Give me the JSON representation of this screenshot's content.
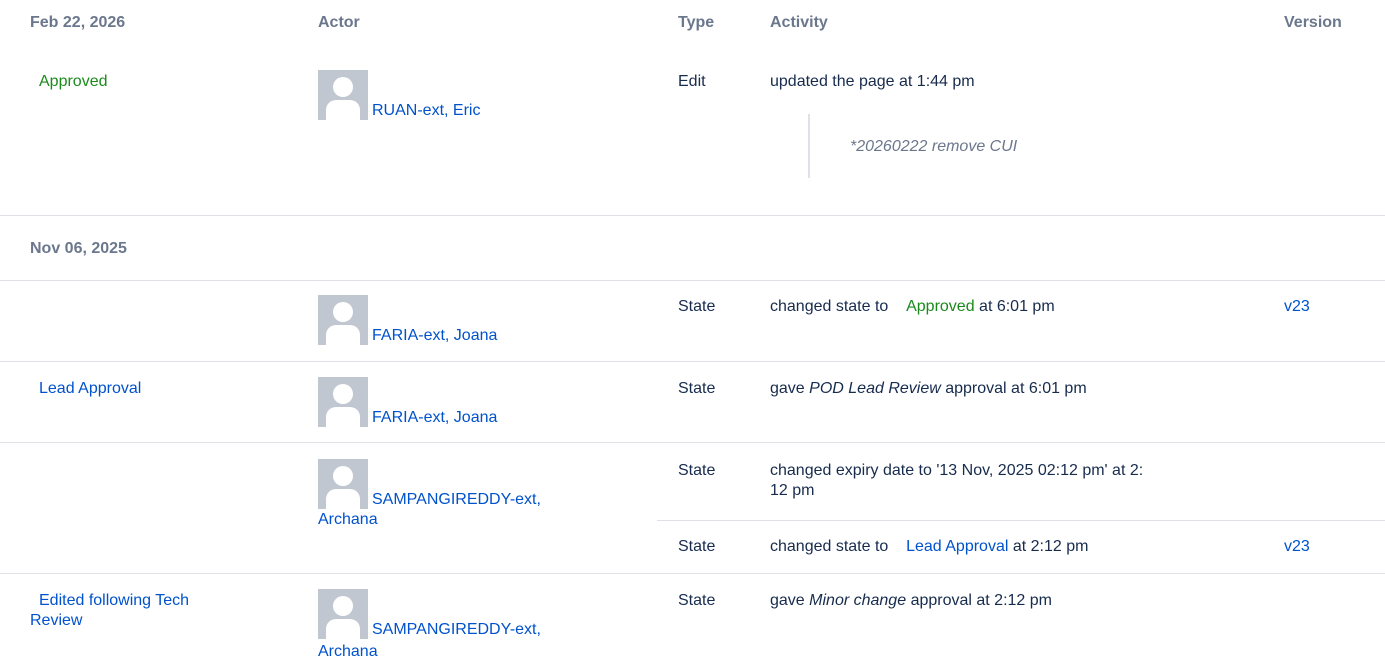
{
  "header": {
    "date": "Feb 22, 2026",
    "actor": "Actor",
    "type": "Type",
    "activity": "Activity",
    "version": "Version"
  },
  "groups": [
    {
      "entries": [
        {
          "state": "Approved",
          "actor": "RUAN-ext, Eric",
          "type": "Edit",
          "activity": "updated the page at 1:44 pm",
          "comment": "*20260222 remove CUI"
        }
      ]
    },
    {
      "date": "Nov 06, 2025",
      "entries": [
        {
          "actor": "FARIA-ext, Joana",
          "type": "State",
          "activity_prefix": "changed state to",
          "activity_state": "Approved",
          "activity_suffix": "at 6:01 pm",
          "version": "v23"
        },
        {
          "state": "Lead Approval",
          "actor": "FARIA-ext, Joana",
          "type": "State",
          "activity_prefix": "gave",
          "activity_em": "POD Lead Review",
          "activity_suffix": "approval at 6:01 pm"
        },
        {
          "actor_line1": "SAMPANGIREDDY-ext,",
          "actor_line2": "Archana",
          "type": "State",
          "activity_line1": "changed expiry date to '13 Nov, 2025 02:12 pm' at 2:",
          "activity_line2": "12 pm"
        },
        {
          "type": "State",
          "activity_prefix": "changed state to",
          "activity_state": "Lead Approval",
          "activity_suffix": "at 2:12 pm",
          "version": "v23"
        },
        {
          "state_line1": "Edited following Tech",
          "state_line2": "Review",
          "actor_line1": "SAMPANGIREDDY-ext,",
          "actor_line2": "Archana",
          "type": "State",
          "activity_prefix": "gave",
          "activity_em": "Minor change",
          "activity_suffix": "approval at 2:12 pm"
        }
      ]
    }
  ],
  "icons": {
    "avatar": "default-avatar-icon"
  },
  "colors": {
    "link": "#0052cc",
    "approved": "#1b8a1b",
    "muted": "#6b778c",
    "divider": "#dfe1e6"
  }
}
